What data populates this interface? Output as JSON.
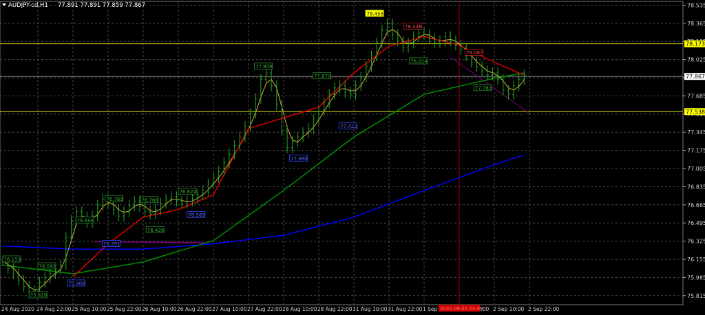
{
  "header": {
    "symbol": "AUDJPY-cd,H1",
    "ohlc": "77.891 77.891 77.859 77.867"
  },
  "colors": {
    "background": "#000000",
    "grid": "#4a4a4a",
    "candle": "#22aa22",
    "ma_fast": "#d8b040",
    "ma_red": "#e00000",
    "ma_green": "#009000",
    "ma_blue": "#0000ff",
    "hline": "#d0d000",
    "bid_line": "#8a8a8a",
    "vline": "#a00000",
    "trendline": "#800080"
  },
  "chart_data": {
    "type": "candlestick",
    "ylim": [
      75.73,
      78.57
    ],
    "y_ticks": [
      "78.535",
      "78.365",
      "78.195",
      "78.025",
      "77.855",
      "77.685",
      "77.515",
      "77.345",
      "77.175",
      "77.005",
      "76.835",
      "76.665",
      "76.495",
      "76.325",
      "76.155",
      "75.985",
      "75.815"
    ],
    "x_ticks": [
      "24 Aug 2020",
      "24 Aug 22:00",
      "25 Aug 10:00",
      "25 Aug 22:00",
      "26 Aug 10:00",
      "26 Aug 22:00",
      "27 Aug 10:00",
      "27 Aug 22:00",
      "28 Aug 10:00",
      "28 Aug 22:00",
      "31 Aug 10:00",
      "31 Aug 22:00",
      "1 Sep 10:00",
      "1 Sep 22:00",
      "2 Sep 10:00",
      "2 Sep 22:00"
    ],
    "x_tick_hours": [
      0,
      12,
      24,
      36,
      48,
      60,
      72,
      84,
      96,
      108,
      120,
      132,
      144,
      156,
      168,
      180
    ],
    "closes": [
      76.14,
      76.07,
      76.02,
      75.96,
      75.9,
      75.84,
      75.86,
      75.94,
      75.98,
      76.02,
      76.06,
      76.1,
      76.36,
      76.52,
      76.6,
      76.55,
      76.5,
      76.56,
      76.66,
      76.72,
      76.68,
      76.62,
      76.56,
      76.6,
      76.66,
      76.7,
      76.65,
      76.6,
      76.58,
      76.62,
      76.68,
      76.72,
      76.74,
      76.7,
      76.68,
      76.7,
      76.72,
      76.76,
      76.8,
      76.86,
      76.92,
      76.98,
      77.06,
      77.14,
      77.22,
      77.3,
      77.4,
      77.52,
      77.66,
      77.84,
      77.9,
      77.78,
      77.6,
      77.36,
      77.2,
      77.26,
      77.3,
      77.34,
      77.38,
      77.46,
      77.54,
      77.62,
      77.7,
      77.76,
      77.78,
      77.72,
      77.7,
      77.78,
      77.86,
      77.96,
      78.06,
      78.18,
      78.3,
      78.36,
      78.26,
      78.2,
      78.14,
      78.18,
      78.24,
      78.28,
      78.26,
      78.22,
      78.18,
      78.2,
      78.24,
      78.2,
      78.16,
      78.12,
      78.06,
      78.0,
      77.96,
      77.92,
      77.88,
      77.9,
      77.84,
      77.74,
      77.7,
      77.78,
      77.84,
      77.88
    ],
    "hours": [
      0,
      1.8,
      3.6,
      5.4,
      7.2,
      9,
      10.8,
      12.6,
      14.4,
      16.2,
      18,
      19.8,
      21.6,
      23.4,
      25.2,
      27,
      28.8,
      30.6,
      32.4,
      34.2,
      36,
      37.8,
      39.6,
      41.4,
      43.2,
      45,
      46.8,
      48.6,
      50.4,
      52.2,
      54,
      55.8,
      57.6,
      59.4,
      61.2,
      63,
      64.8,
      66.6,
      68.4,
      70.2,
      72,
      73.8,
      75.6,
      77.4,
      79.2,
      81,
      82.8,
      84.6,
      86.4,
      88.2,
      90,
      91.8,
      93.6,
      95.4,
      97.2,
      99,
      100.8,
      102.6,
      104.4,
      106.2,
      108,
      109.8,
      111.6,
      113.4,
      115.2,
      117,
      118.8,
      120.6,
      122.4,
      124.2,
      126,
      127.8,
      129.6,
      131.4,
      133.2,
      135,
      136.8,
      138.6,
      140.4,
      142.2,
      144,
      145.8,
      147.6,
      149.4,
      151.2,
      153,
      154.8,
      156.6,
      158.4,
      160.2,
      162,
      163.8,
      165.6,
      167.4,
      169.2,
      171,
      172.8,
      174.6,
      176.4,
      178.2
    ],
    "ma_red": {
      "hours": [
        24,
        36,
        48,
        60,
        72,
        84,
        96,
        108,
        120,
        132,
        144,
        156,
        168,
        178
      ],
      "values": [
        75.99,
        76.3,
        76.55,
        76.62,
        76.76,
        77.38,
        77.48,
        77.58,
        77.9,
        78.15,
        78.24,
        78.16,
        78.0,
        77.88
      ]
    },
    "ma_green": {
      "hours": [
        0,
        24,
        48,
        72,
        96,
        120,
        144,
        168,
        178
      ],
      "values": [
        76.1,
        76.02,
        76.13,
        76.33,
        76.8,
        77.3,
        77.7,
        77.85,
        77.9
      ]
    },
    "ma_blue": {
      "hours": [
        0,
        24,
        48,
        72,
        96,
        120,
        144,
        168,
        178
      ],
      "values": [
        76.28,
        76.25,
        76.25,
        76.3,
        76.38,
        76.55,
        76.8,
        77.04,
        77.13
      ]
    },
    "horizontal_lines": [
      {
        "value": 78.173,
        "label": "78.173"
      },
      {
        "value": 77.538,
        "label": "77.538"
      }
    ],
    "bid_line": {
      "value": 77.867,
      "label": "77.867"
    },
    "vertical_line": {
      "hour": 156,
      "label": "2020.09.02 04:00"
    },
    "trendline": {
      "from": {
        "hour": 153,
        "value": 78.05
      },
      "to": {
        "hour": 180,
        "value": 77.52
      }
    },
    "purple_line": {
      "from": {
        "hour": 31,
        "value": 76.32
      },
      "to": {
        "hour": 69,
        "value": 76.31
      }
    },
    "swing_labels": [
      {
        "text": "76.153",
        "hour": 0,
        "value": 76.155,
        "color": "green"
      },
      {
        "text": "76.093",
        "hour": 12,
        "value": 76.09,
        "color": "green"
      },
      {
        "text": "75.819",
        "hour": 9,
        "value": 75.82,
        "color": "green"
      },
      {
        "text": "75.968",
        "hour": 22,
        "value": 75.93,
        "color": "blue"
      },
      {
        "text": "76.606",
        "hour": 25,
        "value": 76.52,
        "color": "green"
      },
      {
        "text": "76.769",
        "hour": 35,
        "value": 76.72,
        "color": "green"
      },
      {
        "text": "76.291",
        "hour": 34,
        "value": 76.3,
        "color": "blue"
      },
      {
        "text": "76.760",
        "hour": 47,
        "value": 76.71,
        "color": "green"
      },
      {
        "text": "76.426",
        "hour": 49,
        "value": 76.43,
        "color": "green"
      },
      {
        "text": "76.824",
        "hour": 60,
        "value": 76.79,
        "color": "green"
      },
      {
        "text": "76.569",
        "hour": 63,
        "value": 76.57,
        "color": "blue"
      },
      {
        "text": "77.959",
        "hour": 86,
        "value": 77.96,
        "color": "green"
      },
      {
        "text": "77.080",
        "hour": 98,
        "value": 77.1,
        "color": "blue"
      },
      {
        "text": "77.870",
        "hour": 106,
        "value": 77.87,
        "color": "green"
      },
      {
        "text": "77.422",
        "hour": 115,
        "value": 77.4,
        "color": "blue"
      },
      {
        "text": "78.455",
        "hour": 124,
        "value": 78.455,
        "color": "yellow"
      },
      {
        "text": "78.348",
        "hour": 137,
        "value": 78.335,
        "color": "red"
      },
      {
        "text": "78.014",
        "hour": 139,
        "value": 78.01,
        "color": "green"
      },
      {
        "text": "78.067",
        "hour": 158,
        "value": 78.09,
        "color": "red"
      },
      {
        "text": "77.783",
        "hour": 161,
        "value": 77.76,
        "color": "green"
      }
    ]
  }
}
